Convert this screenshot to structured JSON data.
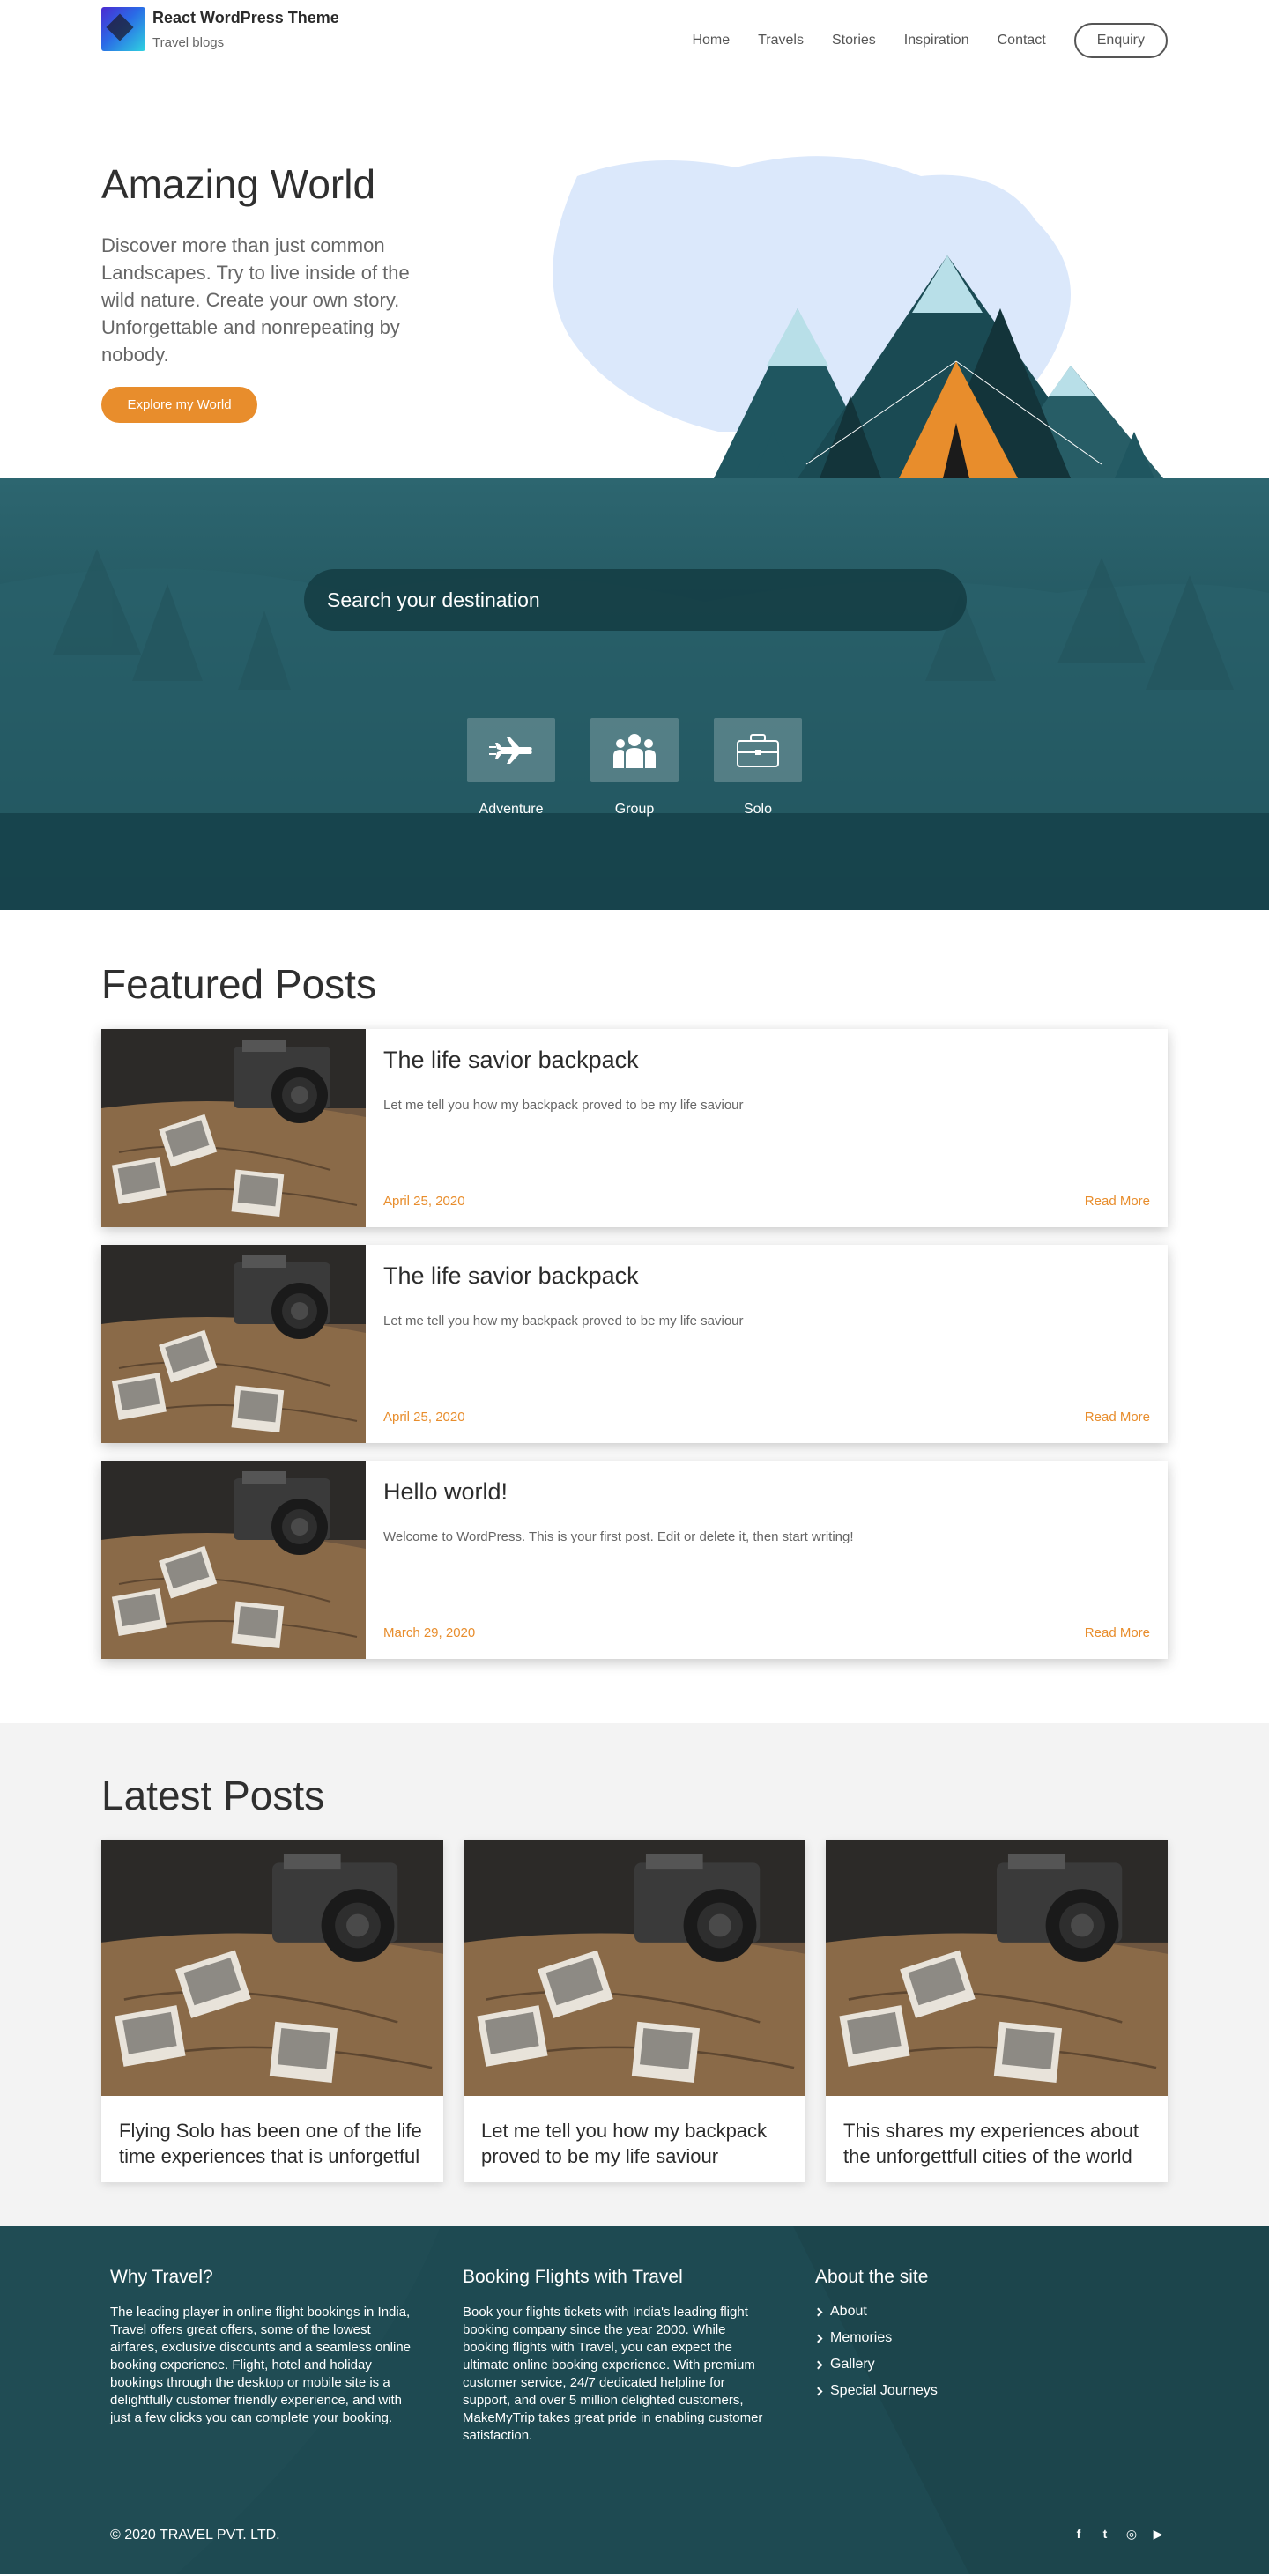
{
  "header": {
    "brand_name": "React WordPress Theme",
    "brand_tagline": "Travel blogs",
    "nav": [
      "Home",
      "Travels",
      "Stories",
      "Inspiration",
      "Contact"
    ],
    "enquiry_label": "Enquiry"
  },
  "hero": {
    "title": "Amazing World",
    "description": "Discover more than just common Landscapes. Try to live inside of the wild nature. Create your own story. Unforgettable and nonrepeating by nobody.",
    "button_label": "Explore my World"
  },
  "search": {
    "placeholder": "Search your destination",
    "categories": [
      {
        "label": "Adventure",
        "icon": "airplane-icon"
      },
      {
        "label": "Group",
        "icon": "group-icon"
      },
      {
        "label": "Solo",
        "icon": "briefcase-icon"
      }
    ]
  },
  "featured": {
    "title": "Featured Posts",
    "posts": [
      {
        "title": "The life savior backpack",
        "excerpt": "Let me tell you how my backpack proved to be my life saviour",
        "date": "April 25, 2020",
        "read_more": "Read More"
      },
      {
        "title": "The life savior backpack",
        "excerpt": "Let me tell you how my backpack proved to be my life saviour",
        "date": "April 25, 2020",
        "read_more": "Read More"
      },
      {
        "title": "Hello world!",
        "excerpt": "Welcome to WordPress. This is your first post. Edit or delete it, then start writing!",
        "date": "March 29, 2020",
        "read_more": "Read More"
      }
    ]
  },
  "latest": {
    "title": "Latest Posts",
    "posts": [
      {
        "title": "Flying Solo has been one of the life time experiences that is unforgetful"
      },
      {
        "title": "Let me tell you how my backpack proved to be my life saviour"
      },
      {
        "title": "This shares my experiences about the unforgettfull cities of the world"
      }
    ]
  },
  "footer": {
    "why_title": "Why Travel?",
    "why_text": "The leading player in online flight bookings in India, Travel offers great offers, some of the lowest airfares, exclusive discounts and a seamless online booking experience. Flight, hotel and holiday bookings through the desktop or mobile site is a delightfully customer friendly experience, and with just a few clicks you can complete your booking.",
    "booking_title": "Booking Flights with Travel",
    "booking_text": "Book your flights tickets with India's leading flight booking company since the year 2000. While booking flights with Travel, you can expect the ultimate online booking experience. With premium customer service, 24/7 dedicated helpline for support, and over 5 million delighted customers, MakeMyTrip takes great pride in enabling customer satisfaction.",
    "about_title": "About the site",
    "about_links": [
      "About",
      "Memories",
      "Gallery",
      "Special Journeys"
    ],
    "copyright": "© 2020 TRAVEL PVT. LTD.",
    "socials": [
      {
        "name": "facebook-icon",
        "glyph": "f"
      },
      {
        "name": "twitter-icon",
        "glyph": "t"
      },
      {
        "name": "instagram-icon",
        "glyph": "◎"
      },
      {
        "name": "youtube-icon",
        "glyph": "▶"
      }
    ]
  },
  "colors": {
    "accent": "#e88d2c",
    "teal_dark": "#1e4a52",
    "teal": "#2d6670"
  }
}
